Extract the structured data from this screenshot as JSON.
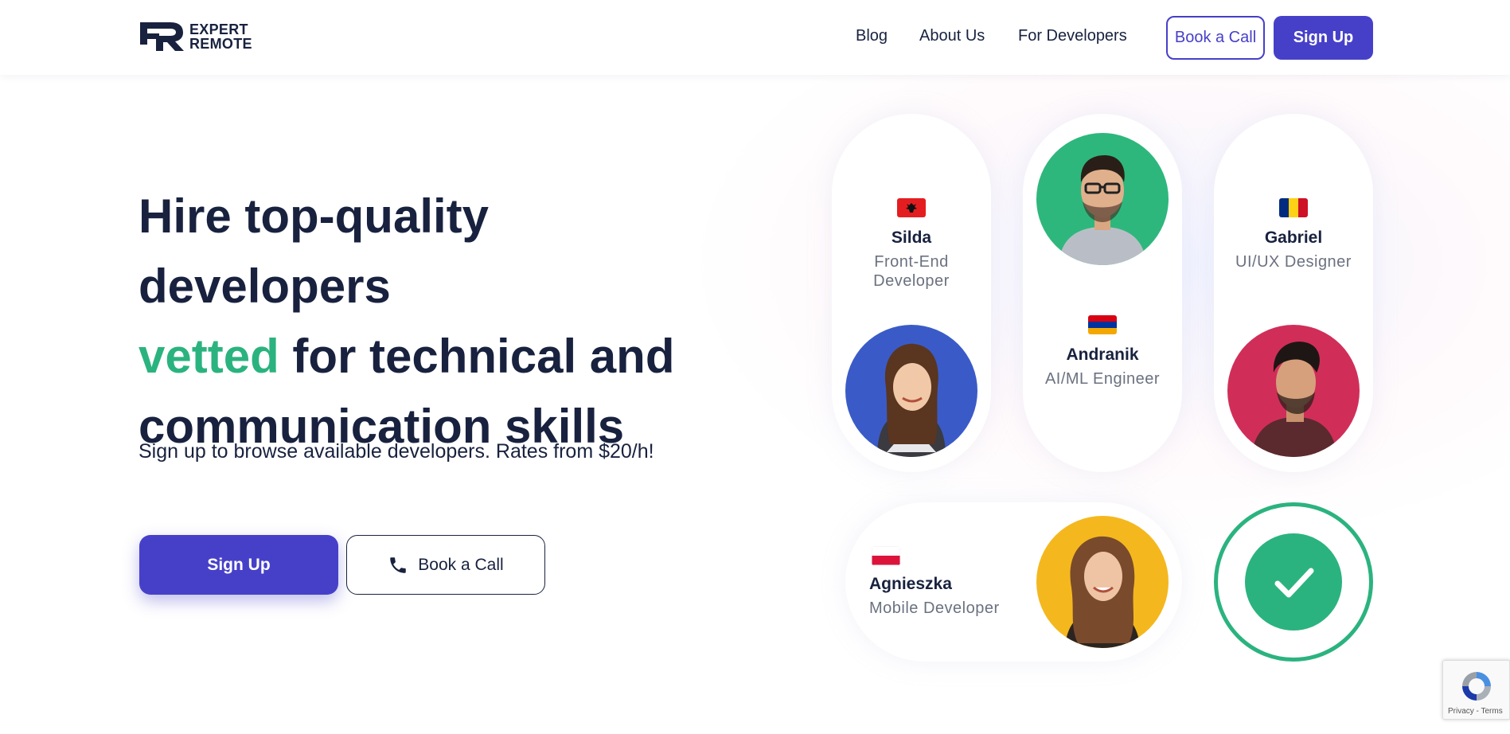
{
  "header": {
    "logo_line1": "EXPERT",
    "logo_line2": "REMOTE",
    "nav": [
      "Blog",
      "About Us",
      "For Developers"
    ],
    "book_call": "Book a Call",
    "sign_up": "Sign Up"
  },
  "hero": {
    "title_line1": "Hire top-quality developers",
    "title_highlight": "vetted",
    "title_line2_rest": " for technical and",
    "title_line3": "communication skills",
    "subtitle": "Sign up to browse available developers. Rates from $20/h!",
    "cta_signup": "Sign Up",
    "cta_call": "Book a Call"
  },
  "developers": [
    {
      "name": "Silda",
      "role": "Front-End Developer",
      "flag": "albania"
    },
    {
      "name": "Gabriel",
      "role": "UI/UX Designer",
      "flag": "romania"
    },
    {
      "name": "Andranik",
      "role": "AI/ML Engineer",
      "flag": "armenia"
    },
    {
      "name": "Agnieszka",
      "role": "Mobile Developer",
      "flag": "poland"
    }
  ],
  "colors": {
    "primary": "#4640c9",
    "accent_green": "#2bb37f",
    "text_dark": "#18223f",
    "text_muted": "#6b7180"
  },
  "icons": [
    "phone-icon",
    "check-icon",
    "recaptcha-icon"
  ],
  "recaptcha": {
    "links": "Privacy - Terms"
  }
}
